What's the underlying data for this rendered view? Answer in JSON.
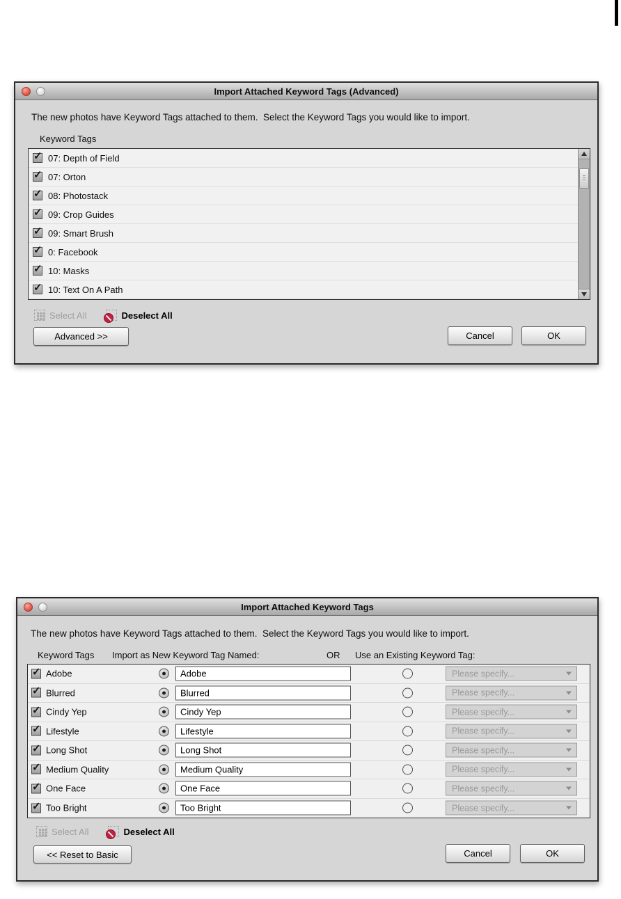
{
  "advanced_dialog": {
    "title": "Import Attached Keyword Tags (Advanced)",
    "instruction": "The new photos have Keyword Tags attached to them.  Select the Keyword Tags you would like to import.",
    "list_label": "Keyword Tags",
    "items": [
      "07: Depth of Field",
      "07: Orton",
      "08: Photostack",
      "09: Crop Guides",
      "09: Smart Brush",
      "0: Facebook",
      "10: Masks",
      "10: Text On A Path"
    ],
    "select_all_label": "Select All",
    "deselect_all_label": "Deselect All",
    "mode_button_label": "Advanced >>",
    "cancel_label": "Cancel",
    "ok_label": "OK"
  },
  "basic_dialog": {
    "title": "Import Attached Keyword Tags",
    "instruction": "The new photos have Keyword Tags attached to them.  Select the Keyword Tags you would like to import.",
    "column_headers": {
      "tags": "Keyword Tags",
      "import_new": "Import as New Keyword Tag Named:",
      "or": "OR",
      "use_existing": "Use an Existing Keyword Tag:"
    },
    "rows": [
      {
        "tag": "Adobe",
        "new_name": "Adobe"
      },
      {
        "tag": "Blurred",
        "new_name": "Blurred"
      },
      {
        "tag": "Cindy Yep",
        "new_name": "Cindy Yep"
      },
      {
        "tag": "Lifestyle",
        "new_name": "Lifestyle"
      },
      {
        "tag": "Long Shot",
        "new_name": "Long Shot"
      },
      {
        "tag": "Medium Quality",
        "new_name": "Medium Quality"
      },
      {
        "tag": "One Face",
        "new_name": "One Face"
      },
      {
        "tag": "Too Bright",
        "new_name": "Too Bright"
      }
    ],
    "existing_placeholder": "Please specify...",
    "select_all_label": "Select All",
    "deselect_all_label": "Deselect All",
    "mode_button_label": "<< Reset to Basic",
    "cancel_label": "Cancel",
    "ok_label": "OK"
  },
  "colors": {
    "dialog_background": "#d6d6d6",
    "titlebar_gradient_top": "#e0e0e0",
    "titlebar_gradient_bottom": "#a8a8a8",
    "close_button_red": "#e4584a",
    "deselect_badge_red": "#c32040",
    "list_row_background": "#f1f1f1",
    "disabled_text": "#9f9f9f",
    "placeholder_text": "#9a9a9a"
  }
}
